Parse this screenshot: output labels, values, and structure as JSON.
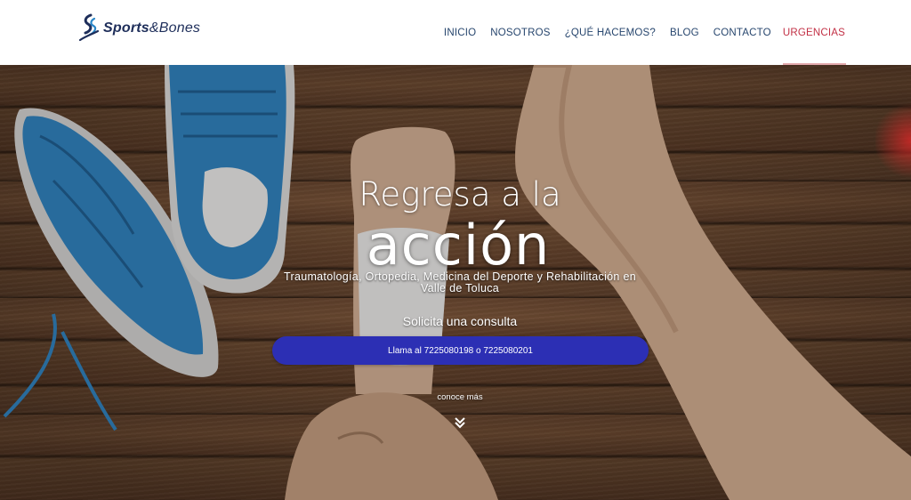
{
  "header": {
    "logo": {
      "brand": "Sports",
      "amp": "&",
      "second": "Bones"
    },
    "nav": [
      {
        "label": "INICIO"
      },
      {
        "label": "NOSOTROS"
      },
      {
        "label": "¿QUÉ HACEMOS?"
      },
      {
        "label": "BLOG"
      },
      {
        "label": "CONTACTO"
      },
      {
        "label": "URGENCIAS"
      }
    ],
    "active_nav": "URGENCIAS"
  },
  "hero": {
    "title_line1": "Regresa a la",
    "title_line2": "acción",
    "subtitle": "Traumatología, Ortopedia, Medicina del Deporte y Rehabilitación en Valle de Toluca",
    "cta_label": "Solicita una consulta",
    "call_button": "Llama al 7225080198 o 7225080201",
    "more_label": "conoce más",
    "scroll_icon": "double-chevron-down-icon"
  },
  "colors": {
    "nav_text": "#27466e",
    "urgent": "#c23045",
    "button": "#2c2fb4",
    "logo": "#1e2e5a"
  }
}
